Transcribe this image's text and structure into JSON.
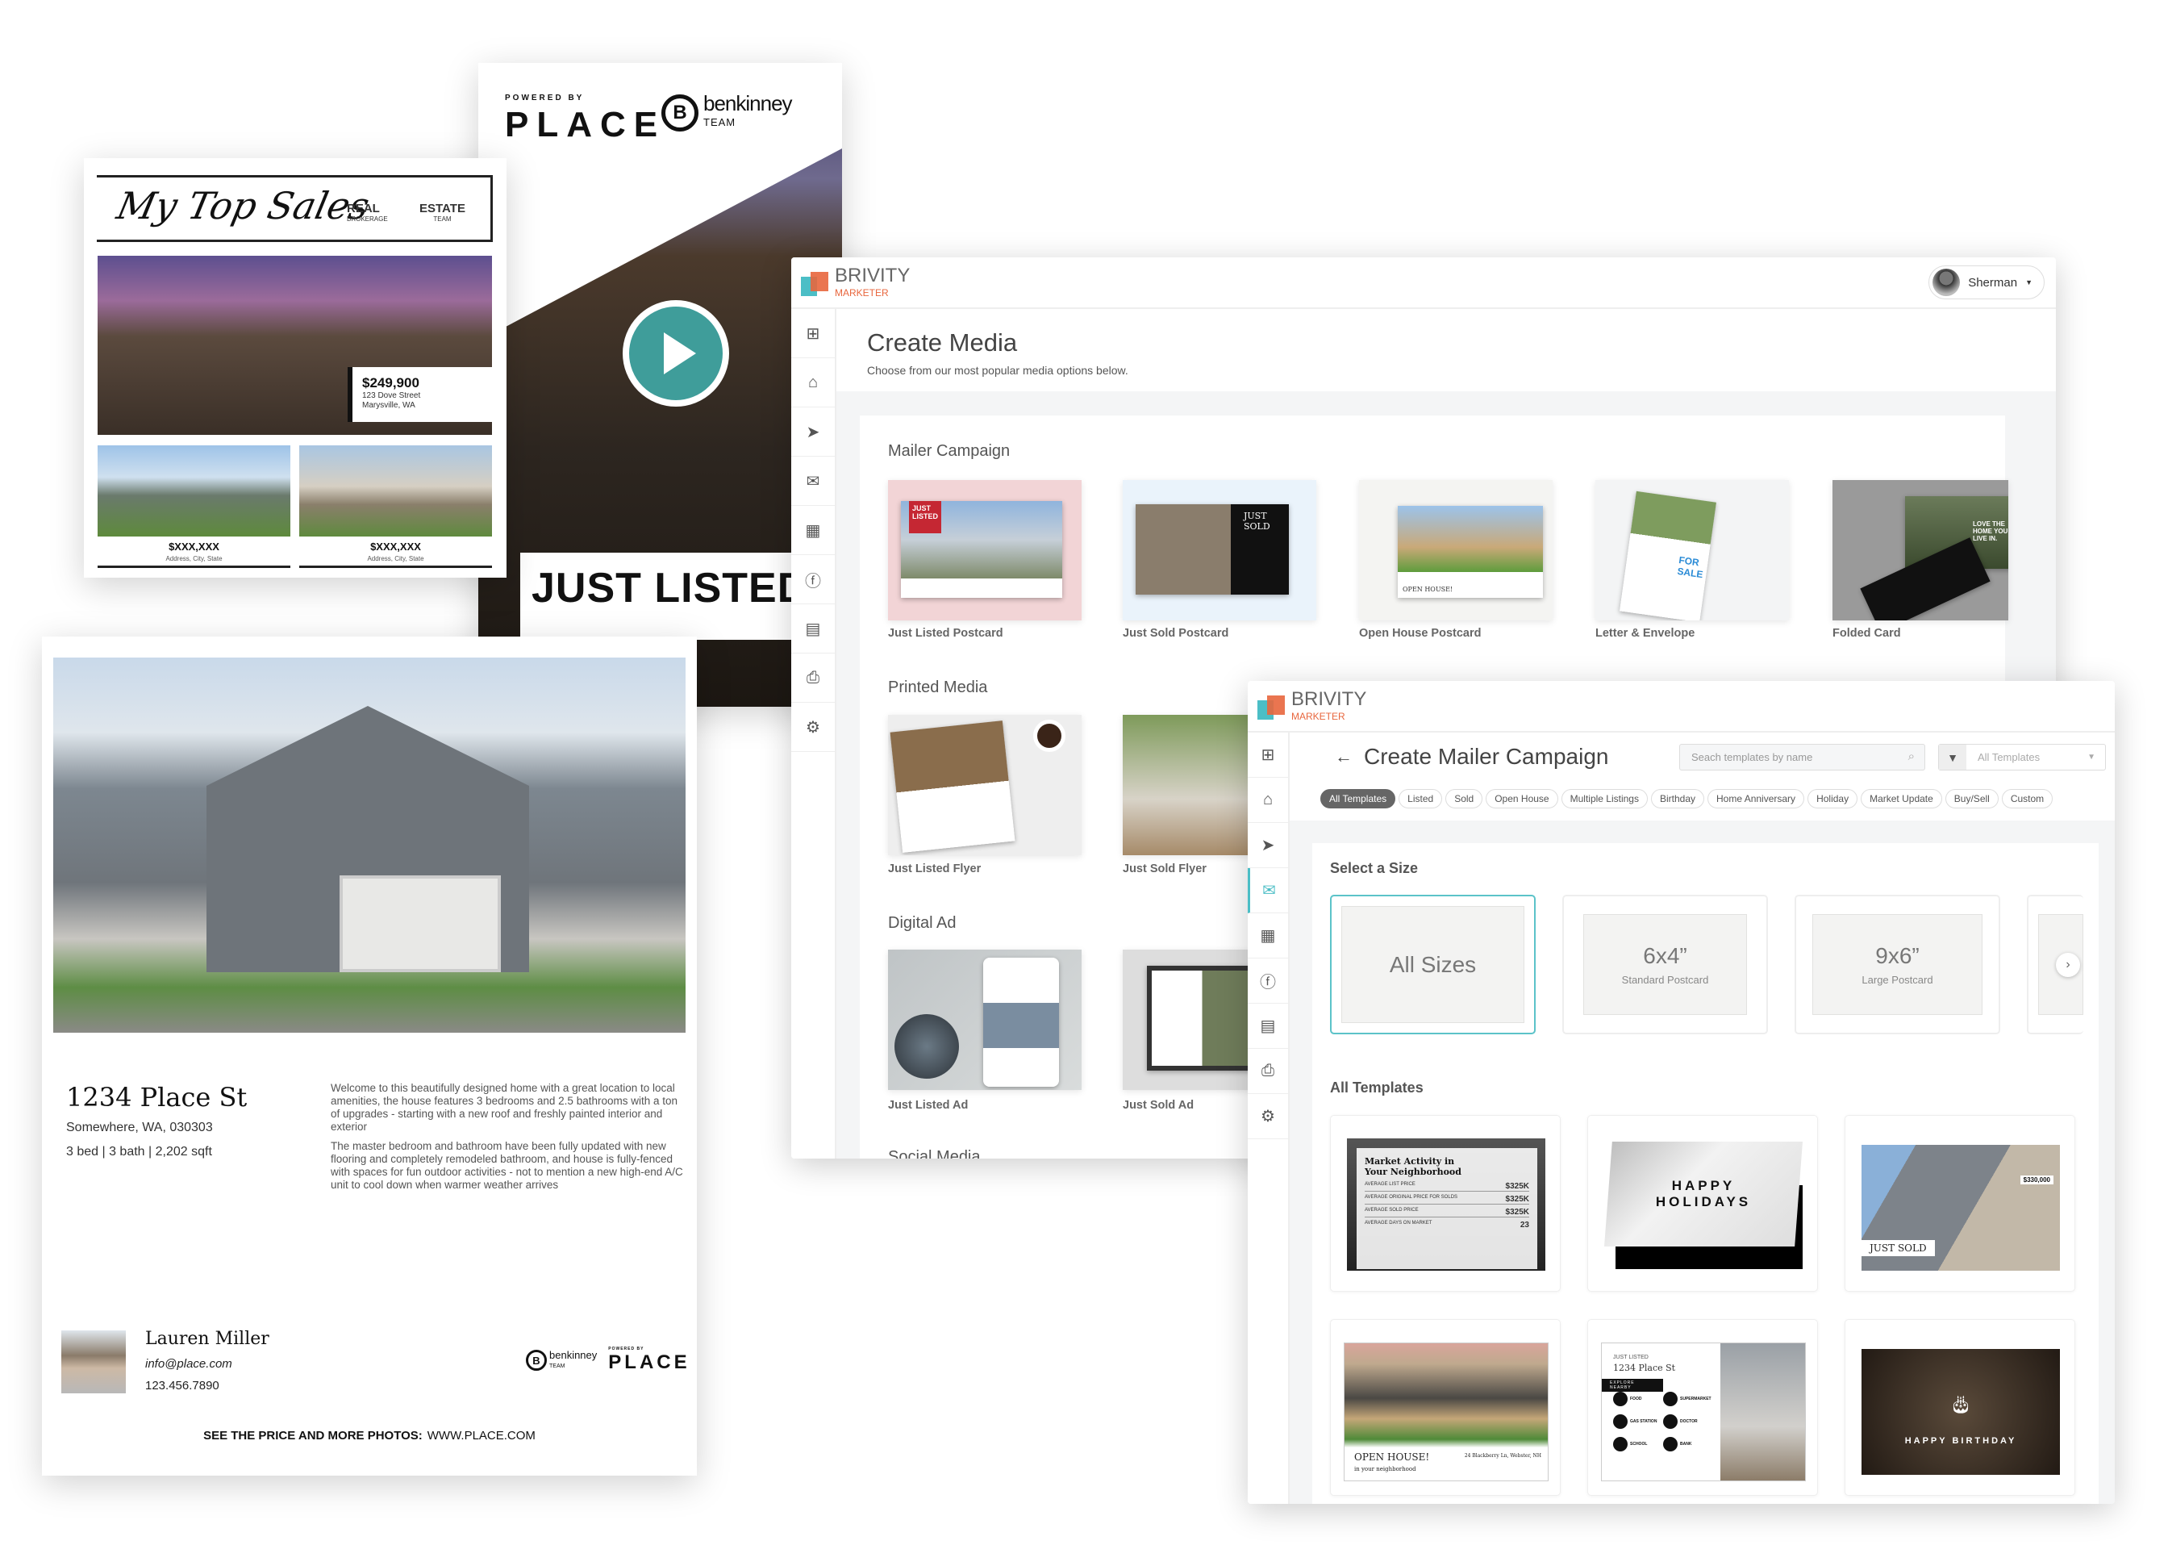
{
  "top_sales_card": {
    "title": "My Top Sales",
    "brand_left": {
      "name": "REAL",
      "sub": "BROKERAGE"
    },
    "brand_right": {
      "name": "ESTATE",
      "sub": "TEAM"
    },
    "featured": {
      "price": "$249,900",
      "street": "123 Dove Street",
      "city": "Marysville, WA"
    },
    "listings": [
      {
        "price": "$XXX,XXX",
        "address": "Address, City, State"
      },
      {
        "price": "$XXX,XXX",
        "address": "Address, City, State"
      }
    ]
  },
  "video_card": {
    "powered_by": "POWERED BY",
    "place_logo": "PLACE",
    "team_logo": {
      "letter": "B",
      "name": "benkinney",
      "sub": "TEAM"
    },
    "banner": "JUST LISTED",
    "play_color": "#3f9d9a"
  },
  "flyer": {
    "address": "1234 Place St",
    "city": "Somewhere, WA, 030303",
    "specs": "3 bed | 3 bath | 2,202 sqft",
    "description": [
      "Welcome to this beautifully designed home with a great location to local amenities, the house features 3 bedrooms and 2.5 bathrooms with a ton of upgrades - starting with a new roof and freshly painted interior and exterior",
      "The master bedroom and bathroom have been fully updated with new flooring and completely remodeled bathroom, and house is fully-fenced with spaces for fun outdoor activities - not to mention a new high-end A/C unit to cool down when warmer weather arrives"
    ],
    "agent": {
      "name": "Lauren Miller",
      "email": "info@place.com",
      "phone": "123.456.7890"
    },
    "logos": {
      "team": "benkinney",
      "team_sub": "TEAM",
      "powered_by": "POWERED BY",
      "place": "PLACE"
    },
    "footer_label": "SEE THE PRICE AND MORE PHOTOS:",
    "footer_url": "WWW.PLACE.COM"
  },
  "brand": {
    "name": "BRIVITY",
    "sub": "MARKETER",
    "accent": "#e8663d",
    "teal": "#4bbec6"
  },
  "create_media": {
    "user": "Sherman",
    "title": "Create Media",
    "subtitle": "Choose from our most popular media options below.",
    "sidebar": [
      "plus-square-icon",
      "home-icon",
      "paper-plane-icon",
      "envelope-icon",
      "grid-icon",
      "facebook-icon",
      "briefcase-icon",
      "printer-icon",
      "gear-icon"
    ],
    "sections": [
      {
        "title": "Mailer Campaign",
        "items": [
          "Just Listed Postcard",
          "Just Sold Postcard",
          "Open House Postcard",
          "Letter & Envelope",
          "Folded Card"
        ]
      },
      {
        "title": "Printed Media",
        "items": [
          "Just Listed Flyer",
          "Just Sold Flyer"
        ]
      },
      {
        "title": "Digital Ad",
        "items": [
          "Just Listed Ad",
          "Just Sold Ad"
        ]
      },
      {
        "title": "Social Media",
        "items": []
      }
    ],
    "thumb_text": {
      "just_listed": "JUST LISTED",
      "just_sold": "JUST SOLD",
      "open_house": "OPEN HOUSE!",
      "for_sale": "FOR SALE",
      "folded": "LOVE THE HOME YOU LIVE IN."
    }
  },
  "mailer_campaign": {
    "title": "Create Mailer Campaign",
    "search_placeholder": "Seach templates by name",
    "filter_value": "All Templates",
    "chips": [
      "All Templates",
      "Listed",
      "Sold",
      "Open House",
      "Multiple Listings",
      "Birthday",
      "Home Anniversary",
      "Holiday",
      "Market Update",
      "Buy/Sell",
      "Custom"
    ],
    "active_chip": "All Templates",
    "select_size_title": "Select a Size",
    "sizes": [
      {
        "main": "All Sizes",
        "sub": "",
        "selected": true
      },
      {
        "main": "6x4”",
        "sub": "Standard Postcard",
        "selected": false
      },
      {
        "main": "9x6”",
        "sub": "Large Postcard",
        "selected": false
      }
    ],
    "all_templates_title": "All Templates",
    "templates": {
      "market": {
        "title": "Market Activity in Your Neighborhood",
        "rows": [
          [
            "AVERAGE LIST PRICE",
            "$325K"
          ],
          [
            "AVERAGE ORIGINAL PRICE FOR SOLDS",
            "$325K"
          ],
          [
            "AVERAGE SOLD PRICE",
            "$325K"
          ],
          [
            "AVERAGE DAYS ON MARKET",
            "23"
          ]
        ]
      },
      "holidays": "HAPPY HOLIDAYS",
      "just_sold": {
        "label": "JUST SOLD",
        "price": "$330,000"
      },
      "open_house": {
        "title": "OPEN HOUSE!",
        "sub": "in your neighborhood",
        "address": "24 Blackberry Ln, Webster, NH"
      },
      "nearby": {
        "eyebrow": "JUST LISTED",
        "address": "1234 Place St",
        "bar": "EXPLORE NEARBY",
        "places": [
          "FOOD",
          "SUPERMARKET",
          "GAS STATION",
          "DOCTOR",
          "SCHOOL",
          "BANK"
        ]
      },
      "birthday": "HAPPY BIRTHDAY"
    }
  }
}
